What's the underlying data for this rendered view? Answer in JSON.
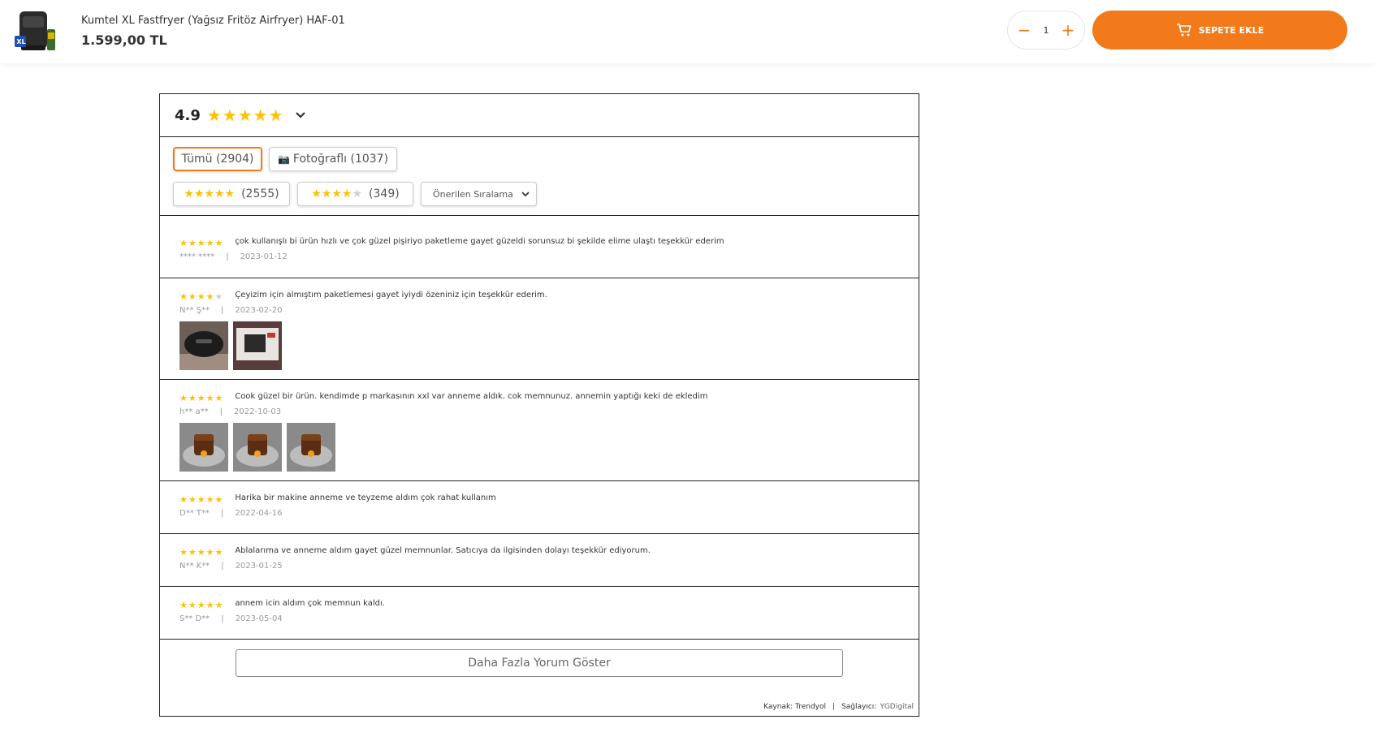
{
  "header": {
    "product_title": "Kumtel XL Fastfryer (Yağsız Fritöz Airfryer) HAF-01",
    "price": "1.599,00 TL",
    "quantity": "1",
    "minus": "−",
    "plus": "+",
    "add_to_cart": "SEPETE EKLE",
    "thumb_badge": "XL"
  },
  "rating": {
    "score": "4.9",
    "stars": "★★★★★",
    "chevron": "⌄"
  },
  "filters": {
    "all": "Tümü (2904)",
    "photos_icon": "📷",
    "photos": "Fotoğraflı (1037)",
    "five_star_stars": "★★★★★",
    "five_star_count": "(2555)",
    "four_star_filled": "★★★★",
    "four_star_empty": "★",
    "four_star_count": "(349)",
    "sort": "Önerilen Sıralama",
    "sort_arrow": "⌄"
  },
  "reviews": [
    {
      "stars": "★★★★★",
      "empty": "",
      "text": "çok kullanışlı bi ürün hızlı ve çok güzel pişiriyo paketleme gayet güzeldi sorunsuz bi şekilde elime ulaştı teşekkür ederim",
      "author": "**** ****",
      "sep": "|",
      "date": "2023-01-12"
    },
    {
      "stars": "★★★★",
      "empty": "★",
      "text": "Çeyizim için almıştım paketlemesi gayet iyiydi özeniniz için teşekkür ederim.",
      "author": "N** Ş**",
      "sep": "|",
      "date": "2023-02-20"
    },
    {
      "stars": "★★★★★",
      "empty": "",
      "text": "Cook güzel bir ürün. kendimde p markasının xxl var anneme aldık. cok memnunuz. annemin yaptığı keki de ekledim",
      "author": "h** a**",
      "sep": "|",
      "date": "2022-10-03"
    },
    {
      "stars": "★★★★★",
      "empty": "",
      "text": "Harika bir makine anneme ve teyzeme aldım çok rahat kullanım",
      "author": "D** T**",
      "sep": "|",
      "date": "2022-04-16"
    },
    {
      "stars": "★★★★★",
      "empty": "",
      "text": "Ablalarıma ve anneme aldım gayet güzel memnunlar. Satıcıya da ilgisinden dolayı teşekkür ediyorum.",
      "author": "N** K**",
      "sep": "|",
      "date": "2023-01-25"
    },
    {
      "stars": "★★★★★",
      "empty": "",
      "text": "annem icin aldım çok memnun kaldı.",
      "author": "S** D**",
      "sep": "|",
      "date": "2023-05-04"
    }
  ],
  "footer": {
    "more_button": "Daha Fazla Yorum Göster",
    "source": "Kaynak: Trendyol",
    "sep": "|",
    "provider_label": "Sağlayıcı:",
    "provider": "YGDigital"
  },
  "colors": {
    "accent": "#f27a1a",
    "star": "#ffc000"
  }
}
